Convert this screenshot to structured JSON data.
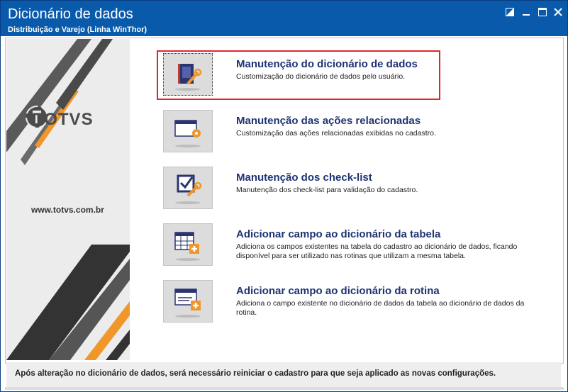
{
  "window": {
    "title": "Dicionário de dados",
    "subtitle": "Distribuição e Varejo (Linha WinThor)"
  },
  "sidebar": {
    "logo_text": "TOTVS",
    "url": "www.totvs.com.br"
  },
  "items": [
    {
      "title": "Manutenção do dicionário de dados",
      "desc": "Customização do dicionário de dados pelo usuário.",
      "icon": "book-wrench-icon"
    },
    {
      "title": "Manutenção das ações relacionadas",
      "desc": "Customização das ações relacionadas exibidas no cadastro.",
      "icon": "window-gear-icon"
    },
    {
      "title": "Manutenção dos check-list",
      "desc": "Manutenção dos check-list para validação do cadastro.",
      "icon": "checkbox-wrench-icon"
    },
    {
      "title": "Adicionar campo ao dicionário da tabela",
      "desc": "Adiciona os campos existentes na tabela do cadastro ao dicionário de dados, ficando disponível para ser utilizado nas rotinas que utilizam a mesma tabela.",
      "icon": "table-add-icon"
    },
    {
      "title": "Adicionar campo ao dicionário da rotina",
      "desc": "Adiciona o campo existente no dicionário de dados da tabela ao dicionário de dados da rotina.",
      "icon": "window-add-icon"
    }
  ],
  "footer": {
    "text": "Após alteração no dicionário de dados, será necessário reiniciar o cadastro para que seja aplicado as novas configurações."
  },
  "colors": {
    "titlebar": "#0a5aac",
    "item_title": "#1e3372",
    "highlight": "#e0262b",
    "accent_orange": "#f0962a"
  }
}
